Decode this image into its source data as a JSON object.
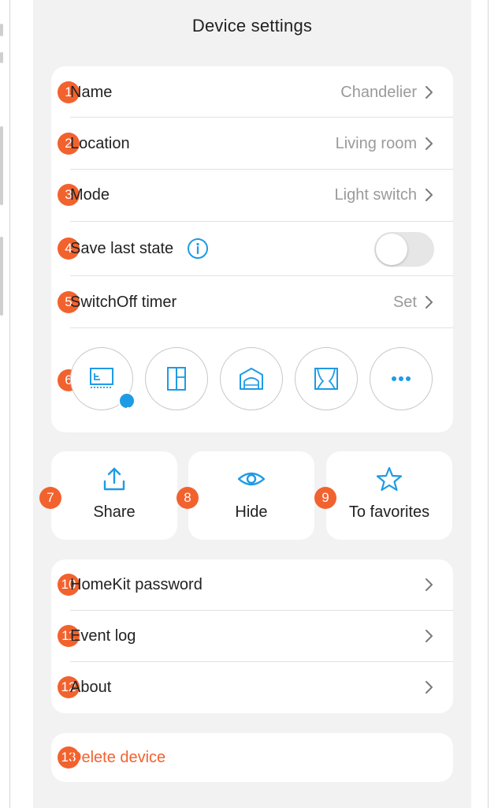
{
  "header": {
    "title": "Device settings"
  },
  "settings": {
    "rows": [
      {
        "num": "1",
        "label": "Name",
        "value": "Chandelier"
      },
      {
        "num": "2",
        "label": "Location",
        "value": "Living room"
      },
      {
        "num": "3",
        "label": "Mode",
        "value": "Light switch"
      },
      {
        "num": "4",
        "label": "Save last state",
        "toggle_on": false
      },
      {
        "num": "5",
        "label": "SwitchOff timer",
        "value": "Set"
      }
    ],
    "device_types": {
      "num": "6",
      "icons": [
        "light-panel-icon",
        "door-icon",
        "garage-icon",
        "curtains-icon",
        "more-dots-icon"
      ],
      "selected": "light-panel-icon"
    }
  },
  "actions": [
    {
      "num": "7",
      "label": "Share",
      "icon": "share-icon"
    },
    {
      "num": "8",
      "label": "Hide",
      "icon": "eye-icon"
    },
    {
      "num": "9",
      "label": "To favorites",
      "icon": "star-icon"
    }
  ],
  "more": {
    "rows": [
      {
        "num": "10",
        "label": "HomeKit password"
      },
      {
        "num": "11",
        "label": "Event log"
      },
      {
        "num": "12",
        "label": "About"
      }
    ]
  },
  "danger": {
    "num": "13",
    "label": "Delete device"
  },
  "colors": {
    "accent": "#f2622e",
    "blue": "#1e9be5",
    "background": "#f2f2f2",
    "card": "#ffffff"
  }
}
